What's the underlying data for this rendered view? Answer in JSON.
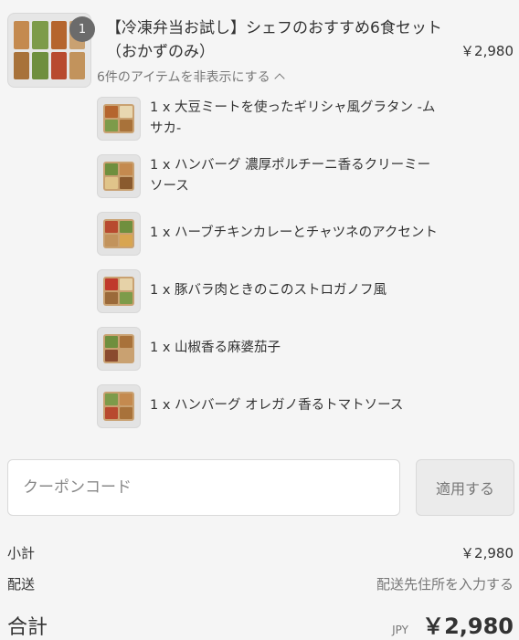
{
  "product": {
    "quantity": "1",
    "title": "【冷凍弁当お試し】シェフのおすすめ6食セット（おかずのみ）",
    "price": "￥2,980",
    "toggle_label": "6件のアイテムを非表示にする"
  },
  "items": [
    {
      "text": "1 x 大豆ミートを使ったギリシャ風グラタン -ムサカ-"
    },
    {
      "text": "1 x ハンバーグ 濃厚ポルチーニ香るクリーミーソース"
    },
    {
      "text": "1 x ハーブチキンカレーとチャツネのアクセント"
    },
    {
      "text": "1 x 豚バラ肉ときのこのストロガノフ風"
    },
    {
      "text": "1 x 山椒香る麻婆茄子"
    },
    {
      "text": "1 x ハンバーグ オレガノ香るトマトソース"
    }
  ],
  "coupon": {
    "placeholder": "クーポンコード",
    "apply_label": "適用する"
  },
  "summary": {
    "subtotal_label": "小計",
    "subtotal_value": "￥2,980",
    "shipping_label": "配送",
    "shipping_value": "配送先住所を入力する",
    "total_label": "合計",
    "currency": "JPY",
    "total_value": "￥2,980"
  }
}
